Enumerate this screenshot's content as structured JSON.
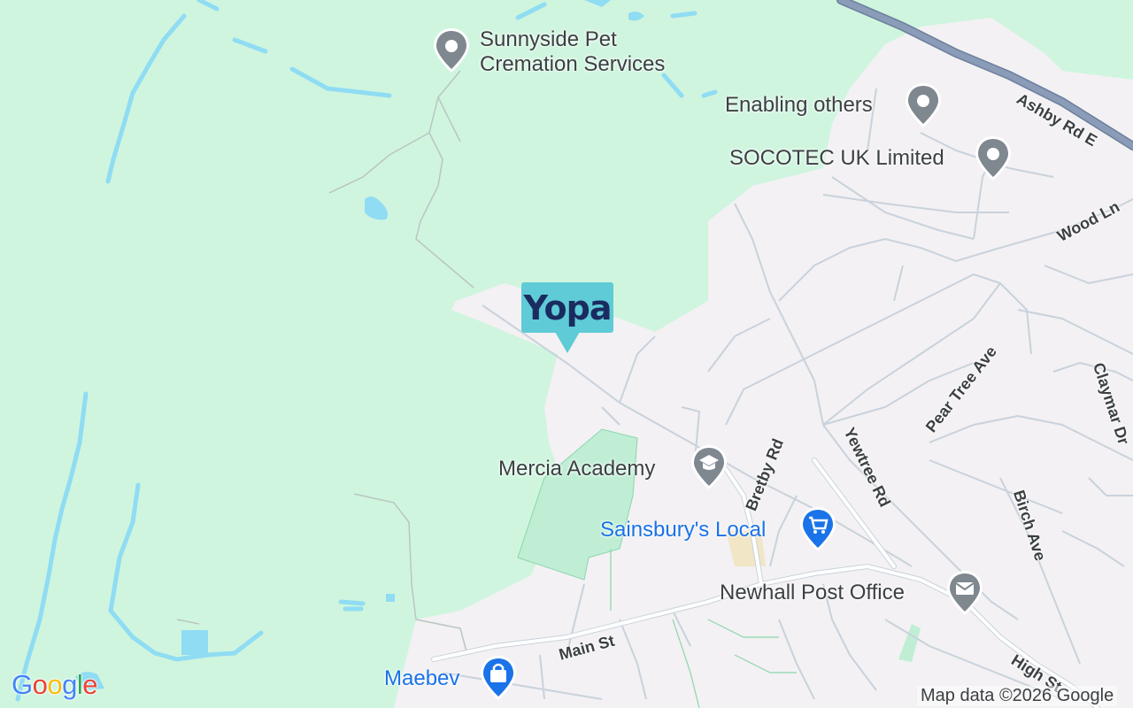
{
  "map": {
    "colors": {
      "greenspace": "#cff5df",
      "urban": "#f3f1f3",
      "water": "#8fdcf3",
      "road": "#ffffff",
      "road_edge": "#c9d2dc",
      "major_road": "#8a9cb8",
      "park": "#bfeed5",
      "poi_gray": "#7f878f",
      "poi_blue": "#1a73e8"
    },
    "pois": [
      {
        "id": "sunnyside",
        "label_line1": "Sunnyside Pet",
        "label_line2": "Cremation Services",
        "icon": "location-pin-icon"
      },
      {
        "id": "enabling",
        "label": "Enabling others",
        "icon": "location-pin-icon"
      },
      {
        "id": "socotec",
        "label": "SOCOTEC UK Limited",
        "icon": "location-pin-icon"
      },
      {
        "id": "mercia",
        "label": "Mercia Academy",
        "icon": "school-icon"
      },
      {
        "id": "sainsburys",
        "label": "Sainsbury's Local",
        "icon": "shopping-cart-icon"
      },
      {
        "id": "postoffice",
        "label": "Newhall Post Office",
        "icon": "mail-icon"
      },
      {
        "id": "maebev",
        "label": "Maebev",
        "icon": "shopping-bag-icon"
      }
    ],
    "streets": {
      "ashby": "Ashby Rd E",
      "wood": "Wood Ln",
      "peartree": "Pear Tree Ave",
      "claymar": "Claymar Dr",
      "bretby": "Bretby Rd",
      "yewtree": "Yewtree Rd",
      "birch": "Birch Ave",
      "main": "Main St",
      "high": "High St"
    },
    "marker": {
      "brand": "Yopa",
      "text": "Yopa"
    },
    "footer": {
      "logo": [
        "G",
        "o",
        "o",
        "g",
        "l",
        "e"
      ],
      "logo_colors": [
        "#4285F4",
        "#EA4335",
        "#FBBC05",
        "#4285F4",
        "#34A853",
        "#EA4335"
      ],
      "attribution": "Map data ©2026 Google"
    }
  }
}
